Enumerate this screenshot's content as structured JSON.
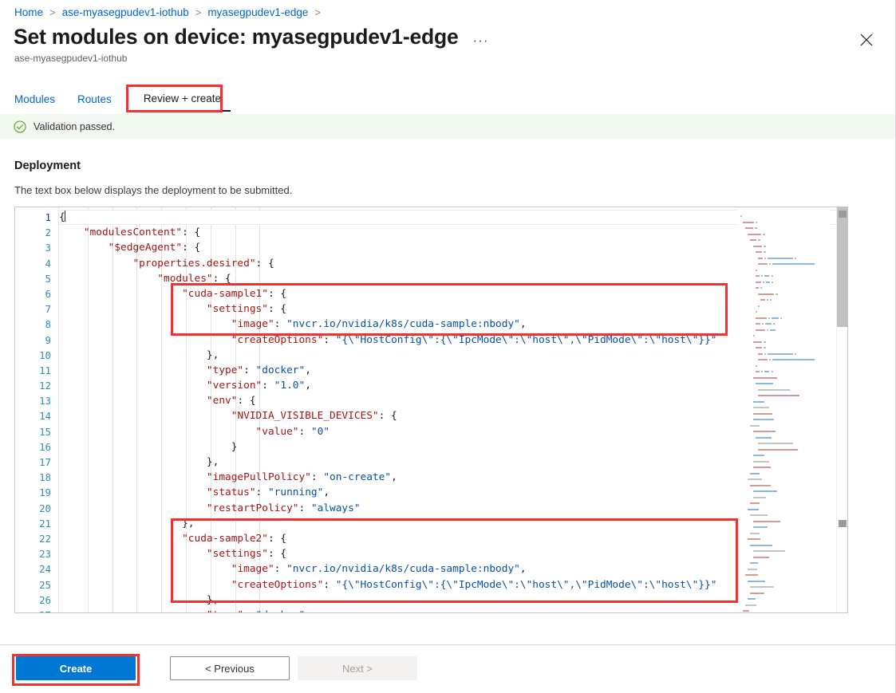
{
  "breadcrumb": {
    "items": [
      {
        "label": "Home"
      },
      {
        "label": "ase-myasegpudev1-iothub"
      },
      {
        "label": "myasegpudev1-edge"
      }
    ],
    "separator": ">"
  },
  "header": {
    "title": "Set modules on device: myasegpudev1-edge",
    "subtitle": "ase-myasegpudev1-iothub",
    "more_label": "···",
    "close_label": "Close"
  },
  "tabs": [
    {
      "label": "Modules",
      "active": false
    },
    {
      "label": "Routes",
      "active": false
    },
    {
      "label": "Review + create",
      "active": true
    }
  ],
  "validation": {
    "icon": "check-circle-icon",
    "text": "Validation passed.",
    "background": "#f2f9f1",
    "accent": "#57a300"
  },
  "deployment": {
    "heading": "Deployment",
    "description": "The text box below displays the deployment to be submitted."
  },
  "editor": {
    "active_line": 1,
    "first_visible_line": 1,
    "last_visible_line": 27,
    "colors": {
      "key": "#a31515",
      "string": "#0451a5",
      "punctuation": "#1b1b1b",
      "line_number": "#2b91af",
      "line_number_active": "#1f3a93"
    },
    "lines": [
      {
        "n": 1,
        "indent": 0,
        "tokens": [
          {
            "t": "p",
            "v": "{"
          }
        ]
      },
      {
        "n": 2,
        "indent": 1,
        "tokens": [
          {
            "t": "k",
            "v": "\"modulesContent\""
          },
          {
            "t": "p",
            "v": ": {"
          }
        ]
      },
      {
        "n": 3,
        "indent": 2,
        "tokens": [
          {
            "t": "k",
            "v": "\"$edgeAgent\""
          },
          {
            "t": "p",
            "v": ": {"
          }
        ]
      },
      {
        "n": 4,
        "indent": 3,
        "tokens": [
          {
            "t": "k",
            "v": "\"properties.desired\""
          },
          {
            "t": "p",
            "v": ": {"
          }
        ]
      },
      {
        "n": 5,
        "indent": 4,
        "tokens": [
          {
            "t": "k",
            "v": "\"modules\""
          },
          {
            "t": "p",
            "v": ": {"
          }
        ]
      },
      {
        "n": 6,
        "indent": 5,
        "tokens": [
          {
            "t": "k",
            "v": "\"cuda-sample1\""
          },
          {
            "t": "p",
            "v": ": {"
          }
        ]
      },
      {
        "n": 7,
        "indent": 6,
        "tokens": [
          {
            "t": "k",
            "v": "\"settings\""
          },
          {
            "t": "p",
            "v": ": {"
          }
        ]
      },
      {
        "n": 8,
        "indent": 7,
        "tokens": [
          {
            "t": "k",
            "v": "\"image\""
          },
          {
            "t": "p",
            "v": ": "
          },
          {
            "t": "s",
            "v": "\"nvcr.io/nvidia/k8s/cuda-sample:nbody\""
          },
          {
            "t": "p",
            "v": ","
          }
        ]
      },
      {
        "n": 9,
        "indent": 7,
        "tokens": [
          {
            "t": "k",
            "v": "\"createOptions\""
          },
          {
            "t": "p",
            "v": ": "
          },
          {
            "t": "s",
            "v": "\"{\\\"HostConfig\\\":{\\\"IpcMode\\\":\\\"host\\\",\\\"PidMode\\\":\\\"host\\\"}}\""
          }
        ]
      },
      {
        "n": 10,
        "indent": 6,
        "tokens": [
          {
            "t": "p",
            "v": "},"
          }
        ]
      },
      {
        "n": 11,
        "indent": 6,
        "tokens": [
          {
            "t": "k",
            "v": "\"type\""
          },
          {
            "t": "p",
            "v": ": "
          },
          {
            "t": "s",
            "v": "\"docker\""
          },
          {
            "t": "p",
            "v": ","
          }
        ]
      },
      {
        "n": 12,
        "indent": 6,
        "tokens": [
          {
            "t": "k",
            "v": "\"version\""
          },
          {
            "t": "p",
            "v": ": "
          },
          {
            "t": "s",
            "v": "\"1.0\""
          },
          {
            "t": "p",
            "v": ","
          }
        ]
      },
      {
        "n": 13,
        "indent": 6,
        "tokens": [
          {
            "t": "k",
            "v": "\"env\""
          },
          {
            "t": "p",
            "v": ": {"
          }
        ]
      },
      {
        "n": 14,
        "indent": 7,
        "tokens": [
          {
            "t": "k",
            "v": "\"NVIDIA_VISIBLE_DEVICES\""
          },
          {
            "t": "p",
            "v": ": {"
          }
        ]
      },
      {
        "n": 15,
        "indent": 8,
        "tokens": [
          {
            "t": "k",
            "v": "\"value\""
          },
          {
            "t": "p",
            "v": ": "
          },
          {
            "t": "s",
            "v": "\"0\""
          }
        ]
      },
      {
        "n": 16,
        "indent": 7,
        "tokens": [
          {
            "t": "p",
            "v": "}"
          }
        ]
      },
      {
        "n": 17,
        "indent": 6,
        "tokens": [
          {
            "t": "p",
            "v": "},"
          }
        ]
      },
      {
        "n": 18,
        "indent": 6,
        "tokens": [
          {
            "t": "k",
            "v": "\"imagePullPolicy\""
          },
          {
            "t": "p",
            "v": ": "
          },
          {
            "t": "s",
            "v": "\"on-create\""
          },
          {
            "t": "p",
            "v": ","
          }
        ]
      },
      {
        "n": 19,
        "indent": 6,
        "tokens": [
          {
            "t": "k",
            "v": "\"status\""
          },
          {
            "t": "p",
            "v": ": "
          },
          {
            "t": "s",
            "v": "\"running\""
          },
          {
            "t": "p",
            "v": ","
          }
        ]
      },
      {
        "n": 20,
        "indent": 6,
        "tokens": [
          {
            "t": "k",
            "v": "\"restartPolicy\""
          },
          {
            "t": "p",
            "v": ": "
          },
          {
            "t": "s",
            "v": "\"always\""
          }
        ]
      },
      {
        "n": 21,
        "indent": 5,
        "tokens": [
          {
            "t": "p",
            "v": "},"
          }
        ]
      },
      {
        "n": 22,
        "indent": 5,
        "tokens": [
          {
            "t": "k",
            "v": "\"cuda-sample2\""
          },
          {
            "t": "p",
            "v": ": {"
          }
        ]
      },
      {
        "n": 23,
        "indent": 6,
        "tokens": [
          {
            "t": "k",
            "v": "\"settings\""
          },
          {
            "t": "p",
            "v": ": {"
          }
        ]
      },
      {
        "n": 24,
        "indent": 7,
        "tokens": [
          {
            "t": "k",
            "v": "\"image\""
          },
          {
            "t": "p",
            "v": ": "
          },
          {
            "t": "s",
            "v": "\"nvcr.io/nvidia/k8s/cuda-sample:nbody\""
          },
          {
            "t": "p",
            "v": ","
          }
        ]
      },
      {
        "n": 25,
        "indent": 7,
        "tokens": [
          {
            "t": "k",
            "v": "\"createOptions\""
          },
          {
            "t": "p",
            "v": ": "
          },
          {
            "t": "s",
            "v": "\"{\\\"HostConfig\\\":{\\\"IpcMode\\\":\\\"host\\\",\\\"PidMode\\\":\\\"host\\\"}}\""
          }
        ]
      },
      {
        "n": 26,
        "indent": 6,
        "tokens": [
          {
            "t": "p",
            "v": "},"
          }
        ]
      },
      {
        "n": 27,
        "indent": 6,
        "tokens": [
          {
            "t": "k",
            "v": "\"type\""
          },
          {
            "t": "p",
            "v": ": "
          },
          {
            "t": "s",
            "v": "\"docker\""
          },
          {
            "t": "p",
            "v": ","
          }
        ]
      }
    ]
  },
  "annotations": {
    "color": "#f03232",
    "boxes": [
      "review-create-tab",
      "cuda-sample1-block",
      "cuda-sample2-block",
      "create-button"
    ]
  },
  "footer": {
    "create_label": "Create",
    "previous_label": "< Previous",
    "next_label": "Next >",
    "next_disabled": true,
    "create_color": "#0078d4"
  }
}
